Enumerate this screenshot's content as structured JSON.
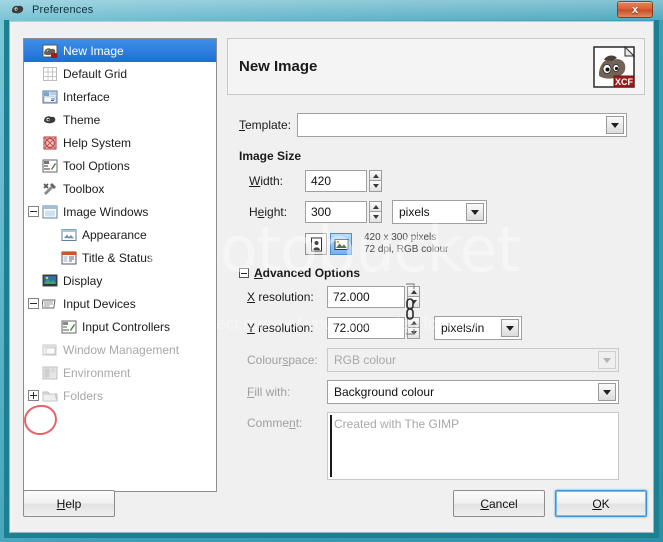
{
  "window": {
    "title": "Preferences",
    "titlebar_icon": "wilber-icon",
    "close_label": "x"
  },
  "sidebar": {
    "items": [
      {
        "label": "New Image",
        "icon": "new-image-icon",
        "depth": 0,
        "expander": "none",
        "selected": true,
        "dimmed": false
      },
      {
        "label": "Default Grid",
        "icon": "grid-icon",
        "depth": 0,
        "expander": "none",
        "selected": false,
        "dimmed": false
      },
      {
        "label": "Interface",
        "icon": "interface-icon",
        "depth": 0,
        "expander": "none",
        "selected": false,
        "dimmed": false
      },
      {
        "label": "Theme",
        "icon": "theme-icon",
        "depth": 0,
        "expander": "none",
        "selected": false,
        "dimmed": false
      },
      {
        "label": "Help System",
        "icon": "help-system-icon",
        "depth": 0,
        "expander": "none",
        "selected": false,
        "dimmed": false
      },
      {
        "label": "Tool Options",
        "icon": "tool-options-icon",
        "depth": 0,
        "expander": "none",
        "selected": false,
        "dimmed": false
      },
      {
        "label": "Toolbox",
        "icon": "toolbox-icon",
        "depth": 0,
        "expander": "none",
        "selected": false,
        "dimmed": false
      },
      {
        "label": "Image Windows",
        "icon": "image-windows-icon",
        "depth": 0,
        "expander": "minus",
        "selected": false,
        "dimmed": false
      },
      {
        "label": "Appearance",
        "icon": "appearance-icon",
        "depth": 1,
        "expander": "none",
        "selected": false,
        "dimmed": false
      },
      {
        "label": "Title & Status",
        "icon": "title-status-icon",
        "depth": 1,
        "expander": "none",
        "selected": false,
        "dimmed": false
      },
      {
        "label": "Display",
        "icon": "display-icon",
        "depth": 0,
        "expander": "none",
        "selected": false,
        "dimmed": false
      },
      {
        "label": "Input Devices",
        "icon": "input-devices-icon",
        "depth": 0,
        "expander": "minus",
        "selected": false,
        "dimmed": false
      },
      {
        "label": "Input Controllers",
        "icon": "input-controllers-icon",
        "depth": 1,
        "expander": "none",
        "selected": false,
        "dimmed": false
      },
      {
        "label": "Window Management",
        "icon": "window-management-icon",
        "depth": 0,
        "expander": "none",
        "selected": false,
        "dimmed": true
      },
      {
        "label": "Environment",
        "icon": "environment-icon",
        "depth": 0,
        "expander": "none",
        "selected": false,
        "dimmed": true
      },
      {
        "label": "Folders",
        "icon": "folders-icon",
        "depth": 0,
        "expander": "plus",
        "selected": false,
        "dimmed": true
      }
    ],
    "annotation": {
      "shape": "red-circle",
      "target": "folders-expander",
      "color": "#e0484c"
    }
  },
  "panel": {
    "header_title": "New Image",
    "header_icon": "xcf-document-icon",
    "template": {
      "label": "Template:",
      "mnemonic": "T",
      "value": "",
      "placeholder": ""
    },
    "image_size": {
      "section_label": "Image Size",
      "width": {
        "label": "Width:",
        "mnemonic": "W",
        "value": "420"
      },
      "height": {
        "label": "Height:",
        "mnemonic": "e",
        "value": "300"
      },
      "unit": "pixels",
      "orientation": {
        "portrait_icon": "portrait-icon",
        "landscape_icon": "landscape-icon",
        "selected": "landscape"
      },
      "info_line_1": "420 x 300 pixels",
      "info_line_2": "72 dpi, RGB colour"
    },
    "advanced": {
      "section_label": "Advanced Options",
      "mnemonic": "A",
      "expanded": true,
      "x_resolution": {
        "label": "X resolution:",
        "mnemonic": "X",
        "value": "72.000"
      },
      "y_resolution": {
        "label": "Y resolution:",
        "mnemonic": "Y",
        "value": "72.000"
      },
      "resolution_unit": "pixels/in",
      "chain_icon": "chain-link-icon",
      "colourspace": {
        "label": "Colourspace:",
        "mnemonic": "s",
        "value": "RGB colour",
        "disabled": true
      },
      "fill_with": {
        "label": "Fill with:",
        "mnemonic": "F",
        "value": "Background colour",
        "disabled": false
      },
      "comment": {
        "label": "Comment:",
        "mnemonic": "n",
        "value": "Created with The GIMP"
      }
    }
  },
  "footer": {
    "help": {
      "label": "Help",
      "mnemonic": "H"
    },
    "cancel": {
      "label": "Cancel",
      "mnemonic": "C"
    },
    "ok": {
      "label": "OK",
      "mnemonic": "O",
      "focused": true
    }
  },
  "watermark": {
    "text": "photobucket",
    "subtext": "Protect more of your memories for less"
  },
  "colors": {
    "window_border": "#1d7f92",
    "selection": "#2f7fdd",
    "close_button": "#d9603a",
    "annotation": "#e0484c",
    "panel_bg": "#f0f0f0"
  }
}
